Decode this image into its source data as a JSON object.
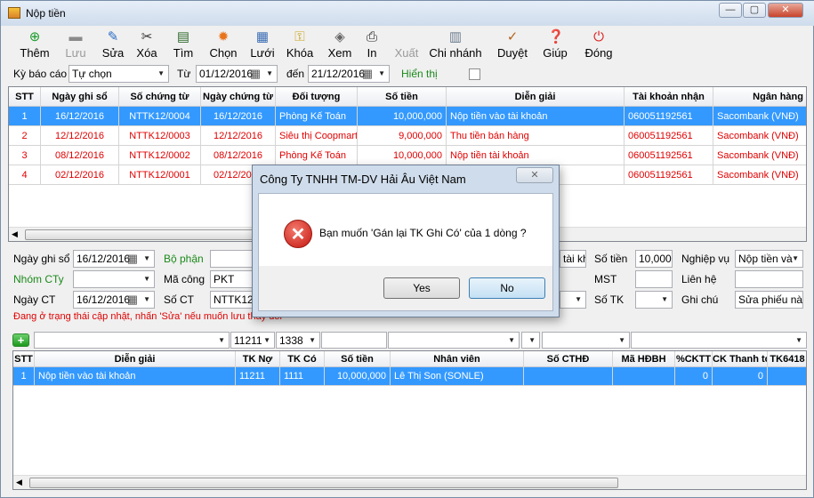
{
  "window": {
    "title": "Nộp tiền",
    "controls": [
      "—",
      "▢",
      "✕"
    ]
  },
  "toolbar": [
    {
      "key": "them",
      "label": "Thêm",
      "icon": "plus-circle-icon",
      "glyph": "⊕",
      "color": "#1a9a2a",
      "enabled": true
    },
    {
      "key": "luu",
      "label": "Lưu",
      "icon": "save-icon",
      "glyph": "▬",
      "color": "#8a8a8a",
      "enabled": false
    },
    {
      "key": "sua",
      "label": "Sửa",
      "icon": "pencil-icon",
      "glyph": "✎",
      "color": "#2a6cc4",
      "enabled": true
    },
    {
      "key": "xoa",
      "label": "Xóa",
      "icon": "scissors-icon",
      "glyph": "✂",
      "color": "#333",
      "enabled": true
    },
    {
      "key": "tim",
      "label": "Tìm",
      "icon": "find-document-icon",
      "glyph": "▤",
      "color": "#2f6a2f",
      "enabled": true
    },
    {
      "key": "chon",
      "label": "Chọn",
      "icon": "gear-icon",
      "glyph": "✹",
      "color": "#e8731a",
      "enabled": true
    },
    {
      "key": "luoi",
      "label": "Lưới",
      "icon": "grid-icon",
      "glyph": "▦",
      "color": "#3a6db5",
      "enabled": true
    },
    {
      "key": "khoa",
      "label": "Khóa",
      "icon": "lock-icon",
      "glyph": "⚿",
      "color": "#c8a31a",
      "enabled": true
    },
    {
      "key": "xem",
      "label": "Xem",
      "icon": "preview-icon",
      "glyph": "◈",
      "color": "#666",
      "enabled": true
    },
    {
      "key": "in",
      "label": "In",
      "icon": "printer-icon",
      "glyph": "⎙",
      "color": "#222",
      "enabled": true
    },
    {
      "key": "xuat",
      "label": "Xuất",
      "icon": "export-icon",
      "glyph": "",
      "color": "#aaa",
      "enabled": false
    },
    {
      "key": "chinhanh",
      "label": "Chi nhánh",
      "icon": "building-icon",
      "glyph": "▥",
      "color": "#6b7c8f",
      "enabled": true
    },
    {
      "key": "duyet",
      "label": "Duyệt",
      "icon": "approve-icon",
      "glyph": "✓",
      "color": "#b5651d",
      "enabled": true
    },
    {
      "key": "giup",
      "label": "Giúp",
      "icon": "help-book-icon",
      "glyph": "❓",
      "color": "#2a6cc4",
      "enabled": true
    },
    {
      "key": "dong",
      "label": "Đóng",
      "icon": "power-icon",
      "glyph": "⏻",
      "color": "#d22",
      "enabled": true
    }
  ],
  "filter": {
    "ky_bao_cao_label": "Kỳ báo cáo",
    "ky_bao_cao_value": "Tự chọn",
    "tu_label": "Từ",
    "tu_value": "01/12/2016",
    "den_label": "đến",
    "den_value": "21/12/2016",
    "hien_thi_label": "Hiển thị"
  },
  "top_grid": {
    "headers": [
      "STT",
      "Ngày ghi sổ",
      "Số chứng từ",
      "Ngày chứng từ",
      "Đối tượng",
      "Số tiền",
      "Diễn giải",
      "Tài khoản nhận",
      "Ngân hàng"
    ],
    "rows": [
      [
        "1",
        "16/12/2016",
        "NTTK12/0004",
        "16/12/2016",
        "Phòng Kế Toán",
        "10,000,000",
        "Nộp tiền vào tài khoản",
        "060051192561",
        "Sacombank (VNĐ)"
      ],
      [
        "2",
        "12/12/2016",
        "NTTK12/0003",
        "12/12/2016",
        "Siêu thị Coopmart",
        "9,000,000",
        "Thu tiền bán hàng",
        "060051192561",
        "Sacombank (VNĐ)"
      ],
      [
        "3",
        "08/12/2016",
        "NTTK12/0002",
        "08/12/2016",
        "Phòng Kế Toán",
        "10,000,000",
        "Nộp tiền tài khoản",
        "060051192561",
        "Sacombank (VNĐ)"
      ],
      [
        "4",
        "02/12/2016",
        "NTTK12/0001",
        "02/12/2016",
        "",
        "",
        "",
        "060051192561",
        "Sacombank (VNĐ)"
      ]
    ]
  },
  "detail": {
    "ngay_ghi_so_label": "Ngày ghi sổ",
    "ngay_ghi_so": "16/12/2016",
    "bo_phan_label": "Bộ phận",
    "nhom_cty_label": "Nhóm CTy",
    "ma_cong_label": "Mã công",
    "ma_cong": "PKT",
    "ngay_ct_label": "Ngày CT",
    "ngay_ct": "16/12/2016",
    "so_ct_label": "Số CT",
    "so_ct": "NTTK12/0",
    "tai_kh_value": "tài kh",
    "so_tien_label": "Số tiền",
    "so_tien": "10,000,0",
    "nghiep_vu_label": "Nghiệp vụ",
    "nghiep_vu": "Nộp tiền và",
    "mst_label": "MST",
    "lien_he_label": "Liên hệ",
    "so_tk_label": "Số TK",
    "ghi_chu_label": "Ghi chú",
    "ghi_chu": "Sửa phiếu này",
    "status": "Đang ở trạng thái cập nhật, nhấn 'Sửa' nếu muốn lưu thay đổi"
  },
  "detail_filter": {
    "tk_no": "11211",
    "tk_co": "1338"
  },
  "bottom_grid": {
    "headers": [
      "STT",
      "Diễn giải",
      "TK Nợ",
      "TK Có",
      "Số tiền",
      "Nhân viên",
      "Số CTHĐ",
      "Mã HĐBH",
      "%CKTT",
      "CK Thanh toán",
      "TK6418"
    ],
    "rows": [
      [
        "1",
        "Nộp tiền vào tài khoản",
        "11211",
        "1111",
        "10,000,000",
        "Lê Thị Son (SONLE)",
        "",
        "",
        "0",
        "0",
        ""
      ]
    ]
  },
  "dialog": {
    "title": "Công Ty TNHH TM-DV Hải Âu Việt Nam",
    "message": "Bạn muốn 'Gán lại TK Ghi Có' của 1 dòng ?",
    "yes": "Yes",
    "no": "No",
    "close": "✕"
  }
}
